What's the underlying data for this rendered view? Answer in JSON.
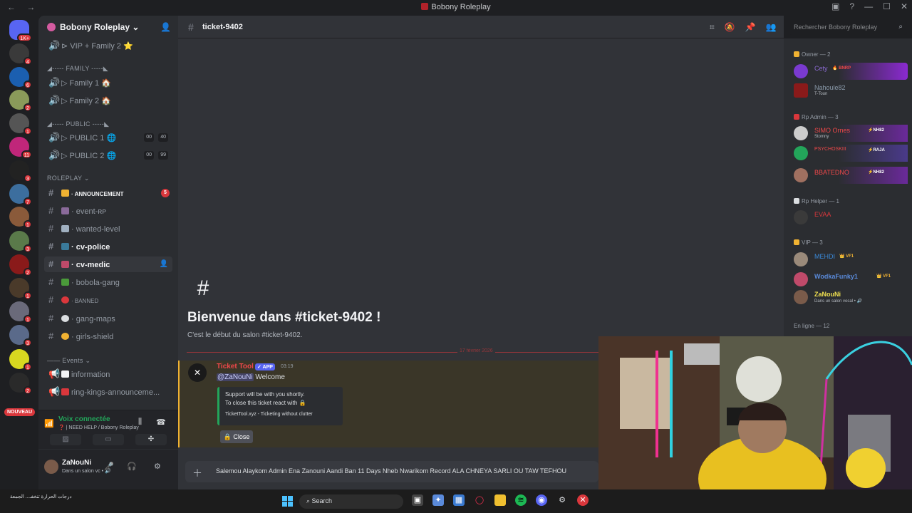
{
  "titlebar": {
    "title": "Bobony Roleplay",
    "nav": "← →",
    "buttons": [
      "▣",
      "?",
      "—",
      "☐",
      "✕"
    ]
  },
  "guilds": {
    "badges": [
      "1K+",
      "4",
      "6",
      "2",
      "1",
      "11",
      "3",
      "7",
      "1",
      "3",
      "2",
      "1",
      "1",
      "3",
      "1",
      "2"
    ],
    "new_label": "NOUVEAU"
  },
  "server": {
    "name": "Bobony Roleplay ⌄"
  },
  "channels": {
    "vip_family2": "⊳ VIP + Family 2 ⭐",
    "cat_family": "◢----- FAMILY -----◣",
    "family1": "▷ Family 1 🏠",
    "family2": "▷ Family 2 🏠",
    "cat_public": "◢----- PUBLIC -----◣",
    "public1": "▷ PUBLIC 1 🌐",
    "public1_a": "00",
    "public1_b": "40",
    "public2": "▷ PUBLIC 2 🌐",
    "public2_a": "00",
    "public2_b": "99",
    "cat_roleplay": "ROLEPLAY ⌄",
    "announcement": "· ANNOUNCEMENT",
    "announcement_unread": "5",
    "event_rp": "· event-ʀᴘ",
    "wanted_level": "· wanted-level",
    "cv_police": "· cv-police",
    "cv_medic": "· cv-medic",
    "bobola_gang": "· bobola-gang",
    "banned": "· BANNED",
    "gang_maps": "· gang-maps",
    "girls_shield": "· girls-shield",
    "cat_events": "—— Events ⌄",
    "information": "information",
    "ring_kings": "ring-kings-announceme..."
  },
  "voice": {
    "state": "Voix connectée",
    "channel": "❓ | NEED HELP / Bobony Roleplay"
  },
  "user": {
    "name": "ZaNouNi",
    "status": "Dans un salon vc • 🔊"
  },
  "chat": {
    "channel_name": "ticket-9402",
    "welcome_title": "Bienvenue dans #ticket-9402 !",
    "welcome_sub": "C'est le début du salon #ticket-9402.",
    "date_divider": "17 février 2026",
    "message": {
      "author": "Ticket Tool",
      "app_badge": "✓ APP",
      "time": "03:19",
      "mention": "@ZaNouNi",
      "text": " Welcome",
      "embed_line1": "Support will be with you shortly.",
      "embed_line2": "To close this ticket react with 🔒",
      "embed_footer": "TicketTool.xyz - Ticketing without clutter",
      "close_button": "🔒 Close"
    },
    "input_text": "Salemou Alaykom Admin Ena Zanouni Aandi Ban 11 Days Nheb Nwarikom Record ALA CHNEYA SARLI OU TAW TEFHOU"
  },
  "search": {
    "placeholder": "Rechercher Bobony Roleplay"
  },
  "members": {
    "owner_cat": "Owner — 2",
    "owner1": "Cety",
    "owner1_tag": "🔥 BNRP",
    "owner2": "Nahoule82",
    "owner2_status": "T-Toun",
    "admin_cat": "Rp Admin — 3",
    "admin1": "SIMO Ornes",
    "admin1_tag": "⚡NH82",
    "admin1_status": "Stomny",
    "admin2": "PSYCHOSKIII",
    "admin2_tag": "⚡RAJA",
    "admin3": "BBATEDNO",
    "admin3_tag": "⚡NH82",
    "helper_cat": "Rp Helper — 1",
    "helper1": "EVAA",
    "vip_cat": "VIP — 3",
    "vip1": "MEHDI",
    "vip1_tag": "👑 VF1",
    "vip2": "WodkaFunky1",
    "vip2_tag": "👑 VF1",
    "vip3": "ZaNouNi",
    "vip3_status": "Dans un salon vocal • 🔊",
    "online_cat": "En ligne — 12"
  },
  "taskbar": {
    "weather": "درجات الحرارة تنخفـ...\nالجمعة",
    "search": "Search"
  },
  "colors": {
    "accent": "#5865f2",
    "danger": "#da373c",
    "online": "#23a55a",
    "mention_bg": "#3a3628"
  }
}
